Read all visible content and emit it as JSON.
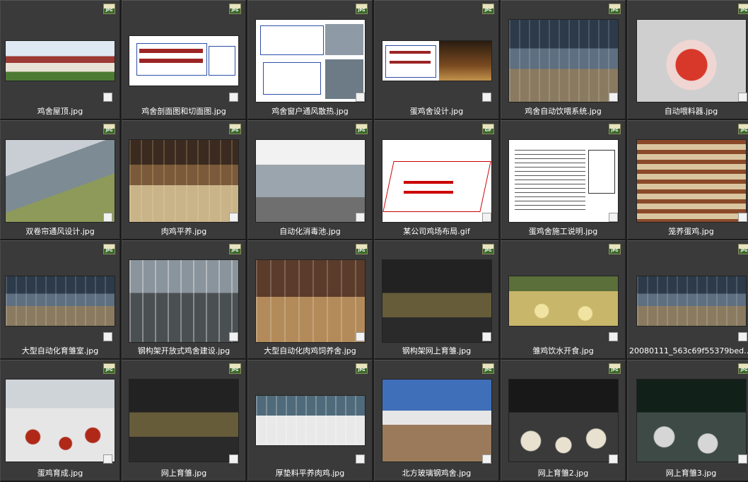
{
  "badges": {
    "jpg": "JPG",
    "gif": "GIF"
  },
  "items": [
    {
      "label": "鸡舍屋顶.jpg",
      "type": "JPG",
      "icon": "roof-photo-icon"
    },
    {
      "label": "鸡舍剖面图和切面图.jpg",
      "type": "JPG",
      "icon": "section-drawing-icon"
    },
    {
      "label": "鸡舍窗户通风散热.jpg",
      "type": "JPG",
      "icon": "window-ventilation-icon"
    },
    {
      "label": "蛋鸡舍设计.jpg",
      "type": "JPG",
      "icon": "layer-house-design-icon"
    },
    {
      "label": "鸡舍自动饮喂系统.jpg",
      "type": "JPG",
      "icon": "feeding-system-icon"
    },
    {
      "label": "自动喂料器.jpg",
      "type": "JPG",
      "icon": "feeder-icon"
    },
    {
      "label": "双卷帘通风设计.jpg",
      "type": "JPG",
      "icon": "curtain-ventilation-icon"
    },
    {
      "label": "肉鸡平养.jpg",
      "type": "JPG",
      "icon": "broiler-floor-icon"
    },
    {
      "label": "自动化消毒池.jpg",
      "type": "JPG",
      "icon": "disinfection-pool-icon"
    },
    {
      "label": "某公司鸡场布局.gif",
      "type": "GIF",
      "icon": "farm-layout-icon"
    },
    {
      "label": "蛋鸡舍施工说明.jpg",
      "type": "JPG",
      "icon": "construction-doc-icon"
    },
    {
      "label": "笼养蛋鸡.jpg",
      "type": "JPG",
      "icon": "caged-hens-icon"
    },
    {
      "label": "大型自动化育雏室.jpg",
      "type": "JPG",
      "icon": "brooding-room-icon"
    },
    {
      "label": "钢构架开放式鸡舍建设.jpg",
      "type": "JPG",
      "icon": "steel-frame-house-icon"
    },
    {
      "label": "大型自动化肉鸡饲养舍.jpg",
      "type": "JPG",
      "icon": "broiler-house-icon"
    },
    {
      "label": "钢构架网上育雏.jpg",
      "type": "JPG",
      "icon": "net-brooding-icon"
    },
    {
      "label": "雏鸡饮水开食.jpg",
      "type": "JPG",
      "icon": "chicks-water-icon"
    },
    {
      "label": "20080111_563c69f55379beda98...",
      "type": "JPG",
      "icon": "house-interior-icon"
    },
    {
      "label": "蛋鸡育成.jpg",
      "type": "JPG",
      "icon": "pullet-rearing-icon"
    },
    {
      "label": "网上育雏.jpg",
      "type": "JPG",
      "icon": "net-brooding-dark-icon"
    },
    {
      "label": "厚垫料平养肉鸡.jpg",
      "type": "JPG",
      "icon": "litter-broiler-icon"
    },
    {
      "label": "北方玻璃钢鸡舍.jpg",
      "type": "JPG",
      "icon": "frp-house-icon"
    },
    {
      "label": "网上育雏2.jpg",
      "type": "JPG",
      "icon": "net-brooding-2-icon"
    },
    {
      "label": "网上育雏3.jpg",
      "type": "JPG",
      "icon": "net-brooding-3-icon"
    }
  ]
}
